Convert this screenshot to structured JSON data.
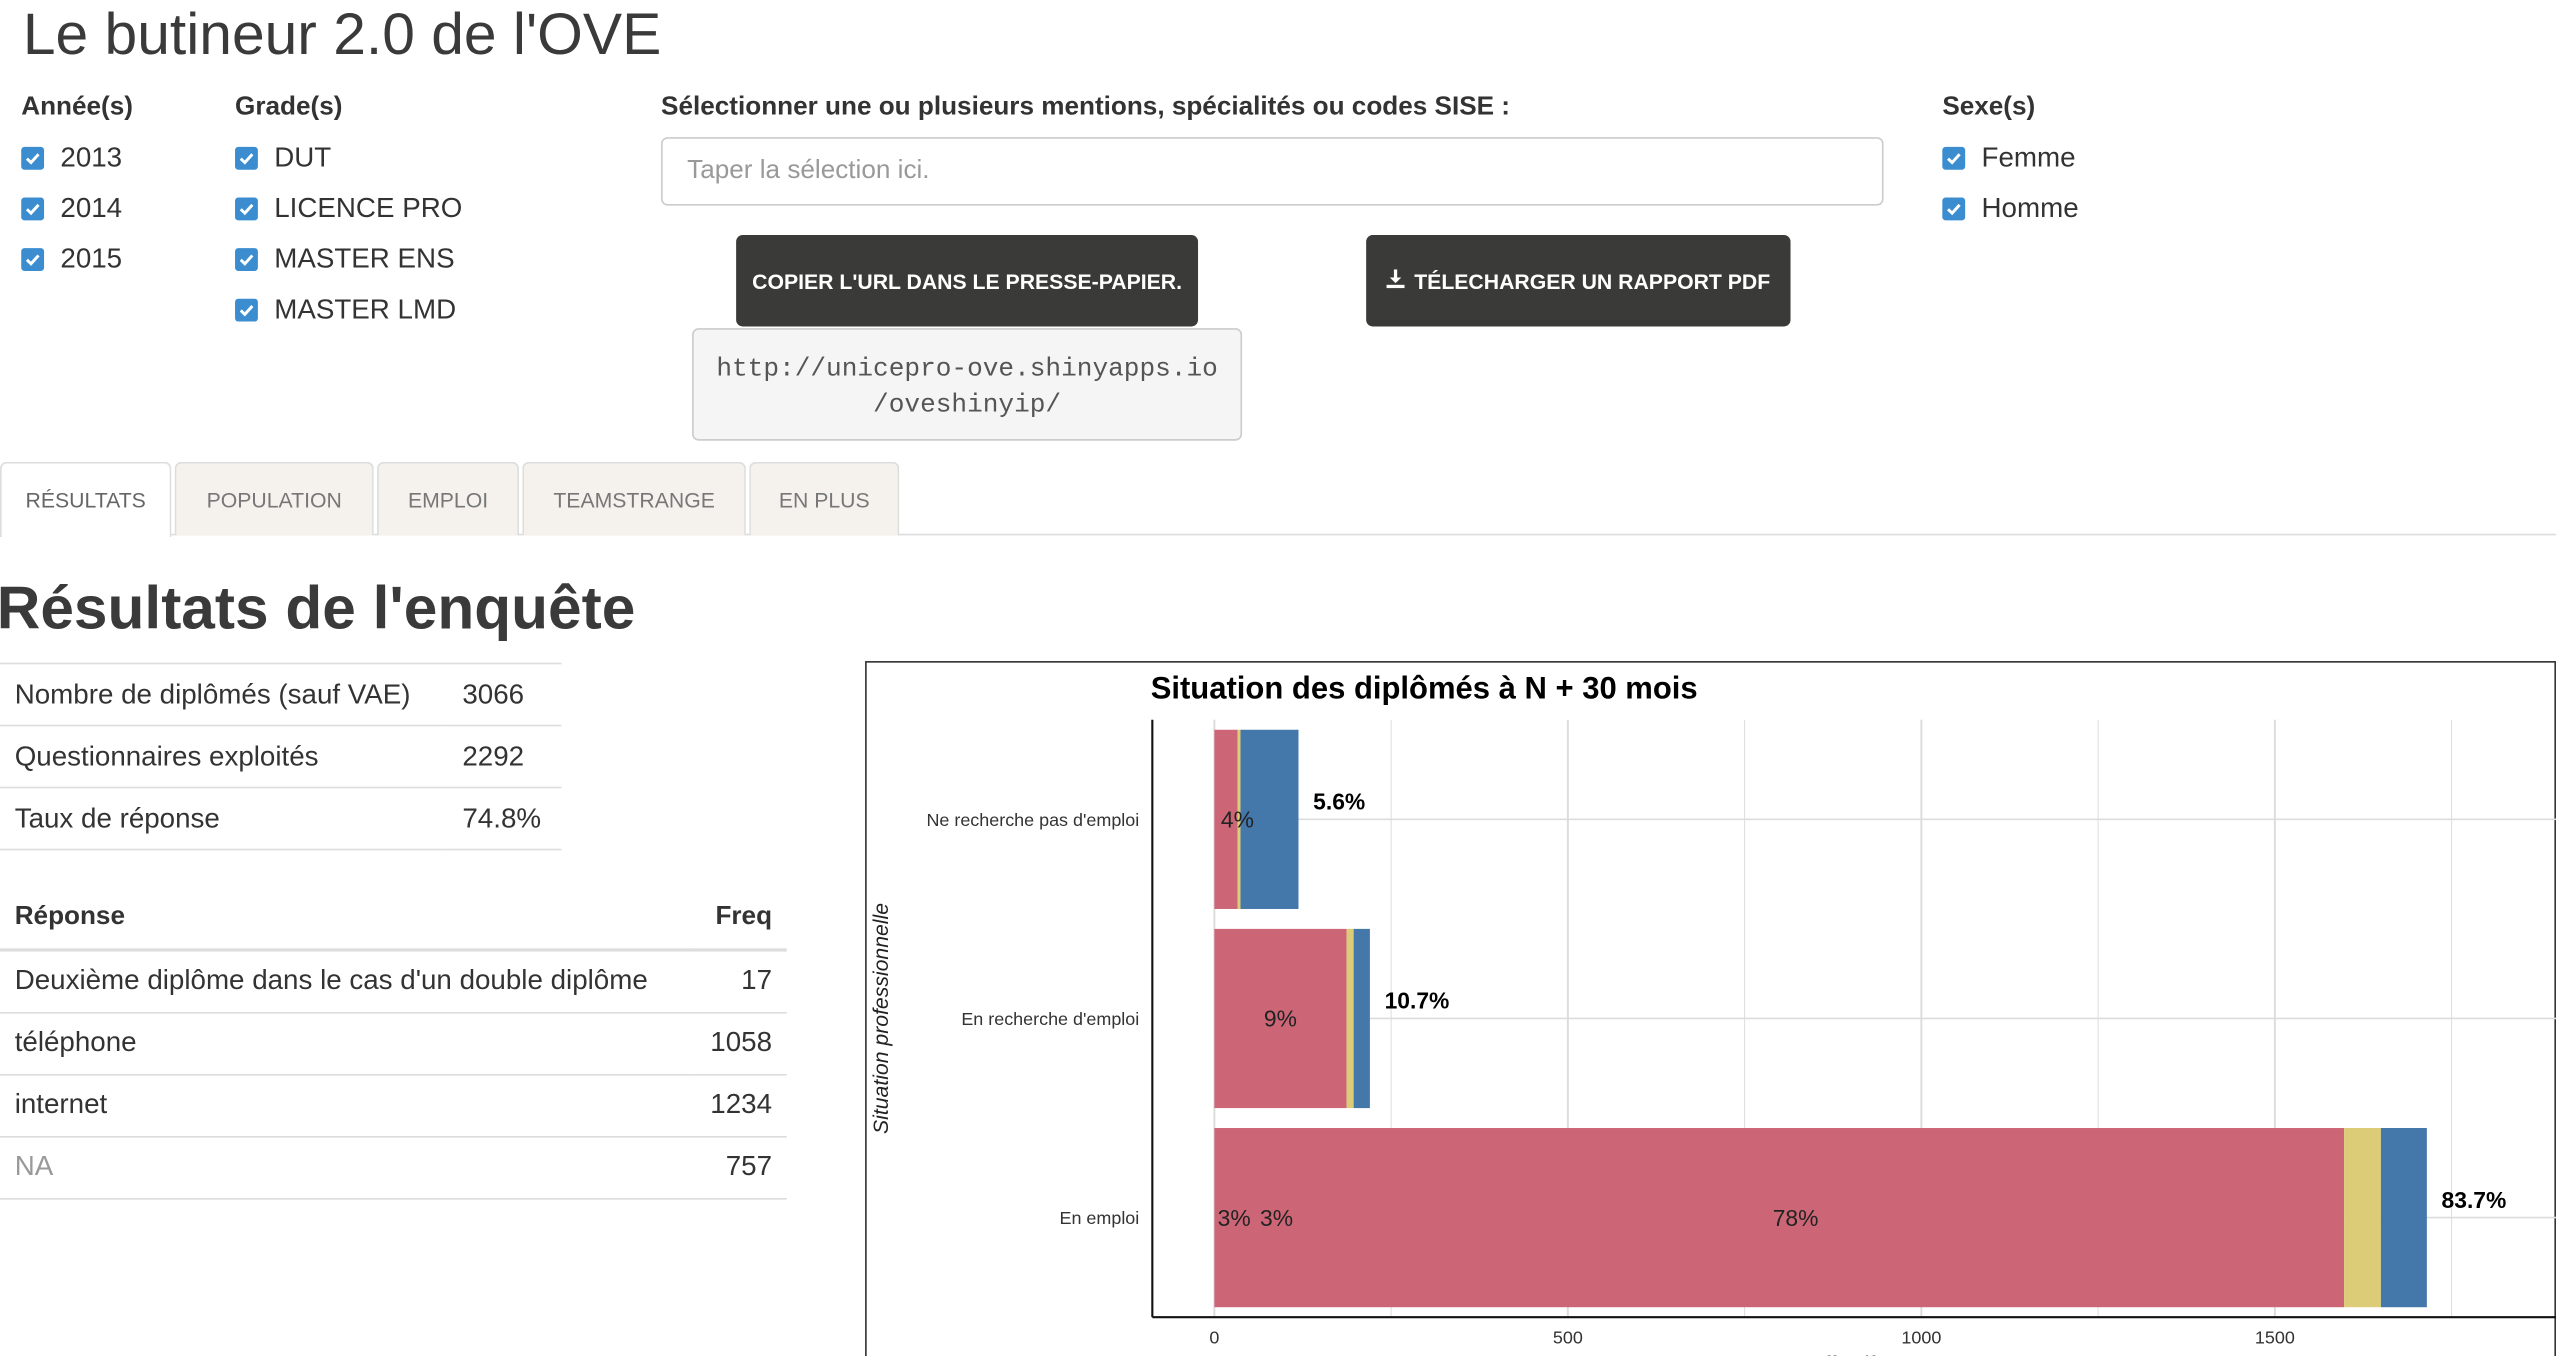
{
  "app": {
    "title": "Le butineur 2.0 de l'OVE"
  },
  "filters": {
    "years": {
      "label": "Année(s)",
      "items": [
        {
          "label": "2013",
          "checked": true
        },
        {
          "label": "2014",
          "checked": true
        },
        {
          "label": "2015",
          "checked": true
        }
      ]
    },
    "grades": {
      "label": "Grade(s)",
      "items": [
        {
          "label": "DUT",
          "checked": true
        },
        {
          "label": "LICENCE PRO",
          "checked": true
        },
        {
          "label": "MASTER ENS",
          "checked": true
        },
        {
          "label": "MASTER LMD",
          "checked": true
        }
      ]
    },
    "sexes": {
      "label": "Sexe(s)",
      "items": [
        {
          "label": "Femme",
          "checked": true
        },
        {
          "label": "Homme",
          "checked": true
        }
      ]
    },
    "sise": {
      "label": "Sélectionner une ou plusieurs mentions, spécialités ou codes SISE :",
      "placeholder": "Taper la sélection ici.",
      "value": ""
    }
  },
  "actions": {
    "copy_url": "COPIER L'URL DANS LE PRESSE-PAPIER.",
    "download_pdf": "TÉLECHARGER UN RAPPORT PDF",
    "url_line1": "http://unicepro-ove.shinyapps.io",
    "url_line2": "/oveshinyip/"
  },
  "tabs": [
    {
      "label": "RÉSULTATS",
      "active": true
    },
    {
      "label": "POPULATION",
      "active": false
    },
    {
      "label": "EMPLOI",
      "active": false
    },
    {
      "label": "TEAMSTRANGE",
      "active": false
    },
    {
      "label": "EN PLUS",
      "active": false
    }
  ],
  "results": {
    "title": "Résultats de l'enquête",
    "summary": [
      {
        "label": "Nombre de diplômés (sauf VAE)",
        "value": "3066"
      },
      {
        "label": "Questionnaires exploités",
        "value": "2292"
      },
      {
        "label": "Taux de réponse",
        "value": "74.8%"
      }
    ],
    "responses": {
      "headers": {
        "response": "Réponse",
        "freq": "Freq"
      },
      "rows": [
        {
          "label": "Deuxième diplôme dans le cas d'un double diplôme",
          "value": "17"
        },
        {
          "label": "téléphone",
          "value": "1058"
        },
        {
          "label": "internet",
          "value": "1234"
        },
        {
          "label": "NA",
          "value": "757"
        }
      ]
    }
  },
  "chart_data": {
    "type": "bar",
    "orientation": "horizontal",
    "stacked": true,
    "title": "Situation des diplômés à N + 30 mois",
    "ylabel": "Situation professionnelle",
    "xlabel": "Effectif",
    "xlim": [
      0,
      1900
    ],
    "xticks": [
      0,
      500,
      1000,
      1500
    ],
    "grid": true,
    "categories": [
      "Ne recherche pas d'emploi",
      "En recherche d'emploi",
      "En emploi"
    ],
    "series": [
      {
        "color": "#cc6677",
        "values": [
          33,
          187,
          1598
        ]
      },
      {
        "color": "#ddcc77",
        "values": [
          4,
          10,
          52
        ]
      },
      {
        "color": "#4477aa",
        "values": [
          82,
          23,
          65
        ]
      }
    ],
    "totals": [
      "5.6%",
      "10.7%",
      "83.7%"
    ],
    "segment_labels": [
      [
        "4%"
      ],
      [
        "9%"
      ],
      [
        "3%",
        "3%",
        "78%"
      ]
    ]
  }
}
